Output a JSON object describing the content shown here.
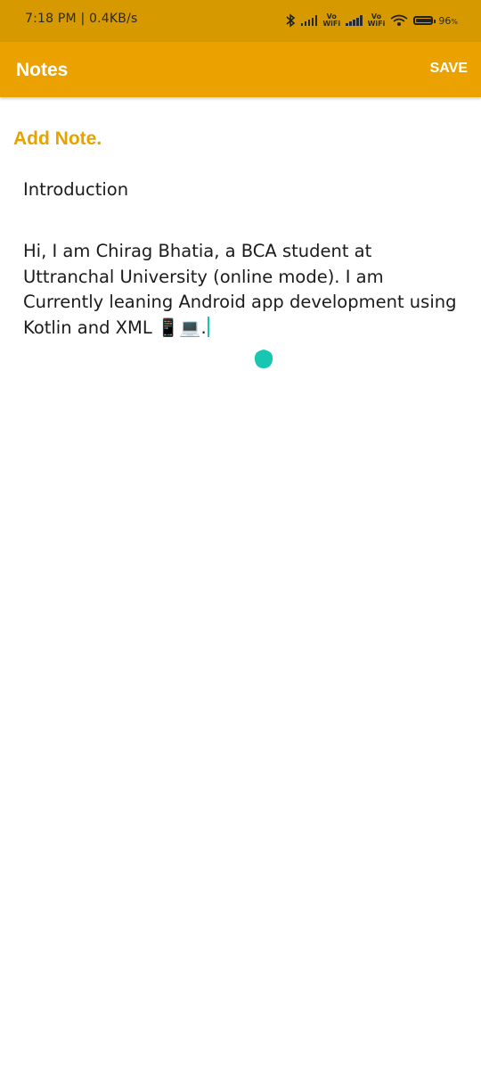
{
  "status_bar": {
    "time": "7:18 PM",
    "network_speed": "0.4KB/s",
    "vo_wifi_label_1": "Vo\nWiFi",
    "vo_wifi_label_2": "Vo\nWiFi",
    "battery_percent": "96",
    "battery_unit": "%",
    "icons": [
      "bluetooth-icon",
      "signal-icon",
      "wifi-icon",
      "battery-icon"
    ]
  },
  "app_bar": {
    "title": "Notes",
    "save_label": "SAVE",
    "color": "#eba200"
  },
  "editor": {
    "heading": "Add Note.",
    "title_value": "Introduction",
    "body_value": "Hi, I am Chirag Bhatia, a BCA student at Uttranchal University (online mode). I am Currently leaning Android app development using Kotlin and XML 📱💻.",
    "accent_color": "#e8a200",
    "cursor_color": "#18c7b2"
  }
}
